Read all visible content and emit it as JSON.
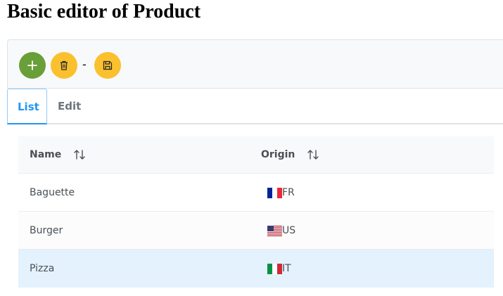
{
  "page": {
    "title": "Basic editor of Product"
  },
  "toolbar": {
    "add_icon": "plus-icon",
    "delete_icon": "trash-icon",
    "separator": "-",
    "save_icon": "save-icon",
    "colors": {
      "add": "#689f38",
      "warning": "#fbc02d"
    }
  },
  "tabs": [
    {
      "label": "List",
      "active": true
    },
    {
      "label": "Edit",
      "active": false
    }
  ],
  "table": {
    "columns": [
      {
        "label": "Name",
        "sort_icon": "sort-alt-icon"
      },
      {
        "label": "Origin",
        "sort_icon": "sort-alt-icon"
      }
    ],
    "rows": [
      {
        "name": "Baguette",
        "origin": "FR",
        "flag": "france-flag-icon",
        "selected": false
      },
      {
        "name": "Burger",
        "origin": "US",
        "flag": "usa-flag-icon",
        "selected": false
      },
      {
        "name": "Pizza",
        "origin": "IT",
        "flag": "italy-flag-icon",
        "selected": true
      }
    ]
  },
  "colors": {
    "accent": "#2196f3",
    "selected_row": "#e3f2fd"
  }
}
